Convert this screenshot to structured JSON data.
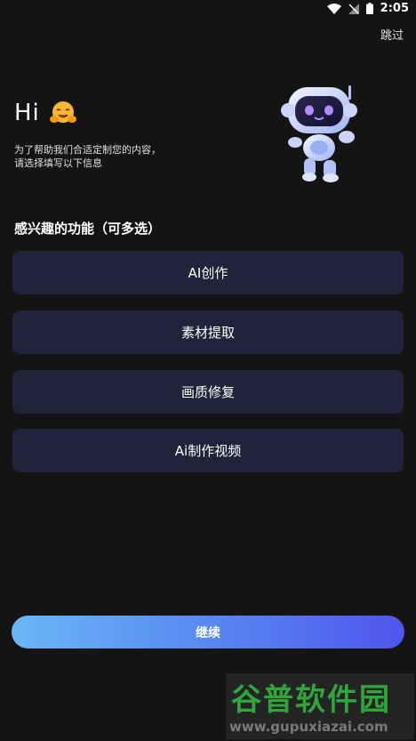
{
  "status_bar": {
    "time": "2:05"
  },
  "header": {
    "skip_label": "跳过"
  },
  "greeting": {
    "hi": "Hi",
    "subtitle_line1": "为了帮助我们合适定制您的内容，",
    "subtitle_line2": "请选择填写以下信息"
  },
  "interests": {
    "title": "感兴趣的功能（可多选）",
    "options": [
      {
        "label": "AI创作"
      },
      {
        "label": "素材提取"
      },
      {
        "label": "画质修复"
      },
      {
        "label": "Ai制作视频"
      }
    ]
  },
  "footer": {
    "continue_label": "继续"
  },
  "watermark": {
    "title": "谷普软件园",
    "url": "www.gupuxiazai.com"
  },
  "colors": {
    "background": "#141414",
    "option_bg": "#22233a",
    "button_gradient_start": "#6bb6f7",
    "button_gradient_end": "#4f55ec"
  }
}
